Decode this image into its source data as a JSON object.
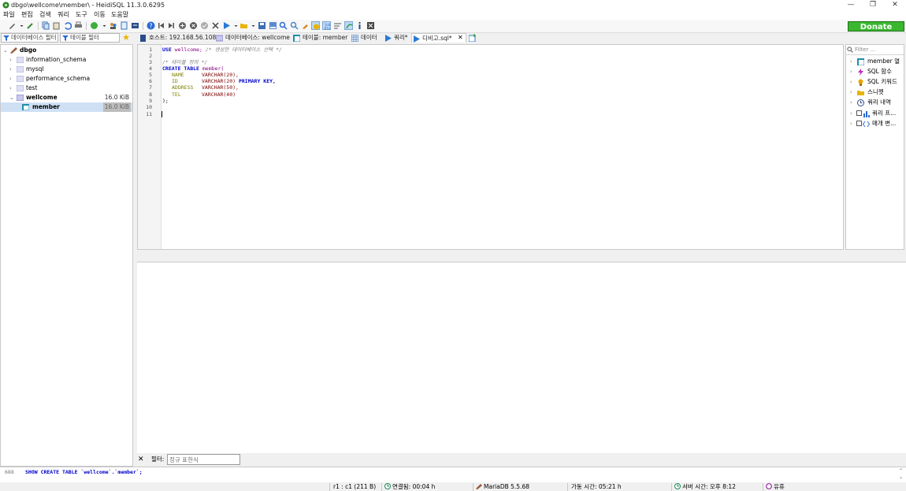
{
  "window": {
    "title": "dbgo\\wellcome\\member\\ - HeidiSQL 11.3.0.6295"
  },
  "menu": [
    "파일",
    "편집",
    "검색",
    "쿼리",
    "도구",
    "이동",
    "도움말"
  ],
  "toolbar": {
    "donate_label": "Donate"
  },
  "filters": {
    "database_placeholder": "데이터베이스 필터",
    "table_placeholder": "테이블 필터"
  },
  "tabs": [
    {
      "label": "호스트: 192.168.56.108",
      "icon": "host-icon"
    },
    {
      "label": "데이터베이스: wellcome",
      "icon": "database-icon"
    },
    {
      "label": "테이블: member",
      "icon": "table-icon"
    },
    {
      "label": "데이터",
      "icon": "data-grid-icon"
    },
    {
      "label": "쿼리*",
      "icon": "query-play-icon"
    },
    {
      "label": "디비고.sql*",
      "icon": "query-play-icon"
    }
  ],
  "tree": {
    "root": "dbgo",
    "databases": [
      {
        "name": "information_schema",
        "size": ""
      },
      {
        "name": "mysql",
        "size": ""
      },
      {
        "name": "performance_schema",
        "size": ""
      },
      {
        "name": "test",
        "size": ""
      },
      {
        "name": "wellcome",
        "size": "16.0 KiB"
      }
    ],
    "child": {
      "name": "member",
      "size": "16.0 KiB"
    }
  },
  "editor": {
    "line_numbers": [
      "1",
      "2",
      "3",
      "4",
      "5",
      "6",
      "7",
      "8",
      "9",
      "10",
      "11"
    ],
    "use_kw": "USE",
    "use_db": "wellcome;",
    "comment1": "/* 생성한 데이터베이스 선택 */",
    "comment2": "/* 테이블 정의 */",
    "create_kw": "CREATE TABLE",
    "table_name": "member(",
    "cols": [
      {
        "name": "NAME",
        "type": "VARCHAR(20),",
        "extra": ""
      },
      {
        "name": "ID",
        "type": "VARCHAR(20)",
        "extra": "PRIMARY KEY,"
      },
      {
        "name": "ADDRESS",
        "type": "VARCHAR(50),",
        "extra": ""
      },
      {
        "name": "TEL",
        "type": "VARCHAR(40)",
        "extra": ""
      }
    ],
    "close": ");"
  },
  "helper": {
    "filter_placeholder": "Filter ...",
    "items": [
      "member 열",
      "SQL 함수",
      "SQL 키워드",
      "스니펫",
      "쿼리 내역",
      "쿼리 프...",
      "매개 변..."
    ]
  },
  "result_filter": {
    "label": "필터:",
    "placeholder": "정규 표현식"
  },
  "log": {
    "line": "688",
    "sql": "SHOW CREATE TABLE `wellcome`.`member`;"
  },
  "status": {
    "position": "r1 : c1 (211 B)",
    "connected": "연결됨: 00:04 h",
    "server": "MariaDB 5.5.68",
    "uptime": "가동 시간: 05:21 h",
    "server_time": "서버 시간: 오후 8:12",
    "idle": "유휴"
  },
  "colors": {
    "accent_green": "#3ab72f",
    "selection": "#cfe0f5",
    "keyword": "#0000cc",
    "comment": "#808080"
  }
}
